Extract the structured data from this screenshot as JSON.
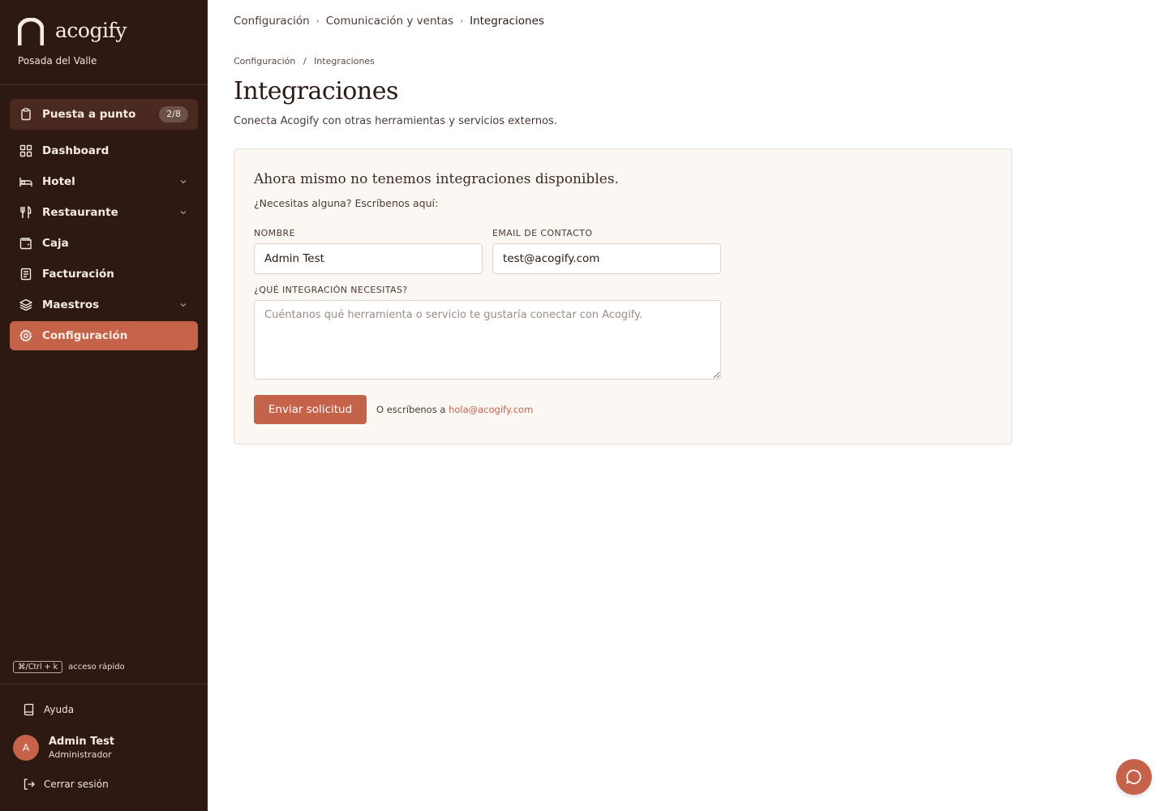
{
  "brand": {
    "name": "acogify",
    "property": "Posada del Valle"
  },
  "sidebar": {
    "setup": {
      "label": "Puesta a punto",
      "badge": "2/8"
    },
    "items": [
      {
        "label": "Dashboard",
        "icon": "grid-icon"
      },
      {
        "label": "Hotel",
        "icon": "bed-icon",
        "expandable": true
      },
      {
        "label": "Restaurante",
        "icon": "utensils-icon",
        "expandable": true
      },
      {
        "label": "Caja",
        "icon": "wallet-icon"
      },
      {
        "label": "Facturación",
        "icon": "receipt-icon"
      },
      {
        "label": "Maestros",
        "icon": "layers-icon",
        "expandable": true
      },
      {
        "label": "Configuración",
        "icon": "gear-icon",
        "active": true
      }
    ],
    "shortcut": {
      "keys": "⌘/Ctrl + k",
      "label": "acceso rápido"
    },
    "help": "Ayuda",
    "user": {
      "initial": "A",
      "name": "Admin Test",
      "role": "Administrador"
    },
    "logout": "Cerrar sesión"
  },
  "topbar": {
    "breadcrumb": [
      "Configuración",
      "Comunicación y ventas",
      "Integraciones"
    ]
  },
  "page": {
    "breadcrumb": [
      "Configuración",
      "Integraciones"
    ],
    "breadcrumb_sep": "/",
    "title": "Integraciones",
    "subtitle": "Conecta Acogify con otras herramientas y servicios externos."
  },
  "card": {
    "title": "Ahora mismo no tenemos integraciones disponibles.",
    "subtitle": "¿Necesitas alguna? Escríbenos aquí:",
    "form": {
      "name_label": "NOMBRE",
      "name_value": "Admin Test",
      "email_label": "EMAIL DE CONTACTO",
      "email_value": "test@acogify.com",
      "integration_label": "¿QUÉ INTEGRACIÓN NECESITAS?",
      "integration_placeholder": "Cuéntanos qué herramienta o servicio te gustaría conectar con Acogify.",
      "submit_label": "Enviar solicitud",
      "alt_prefix": "O escríbenos a",
      "alt_email": "hola@acogify.com"
    }
  },
  "colors": {
    "sidebar_bg": "#2d1812",
    "accent": "#c4624a",
    "card_bg": "#fbf7f3"
  }
}
